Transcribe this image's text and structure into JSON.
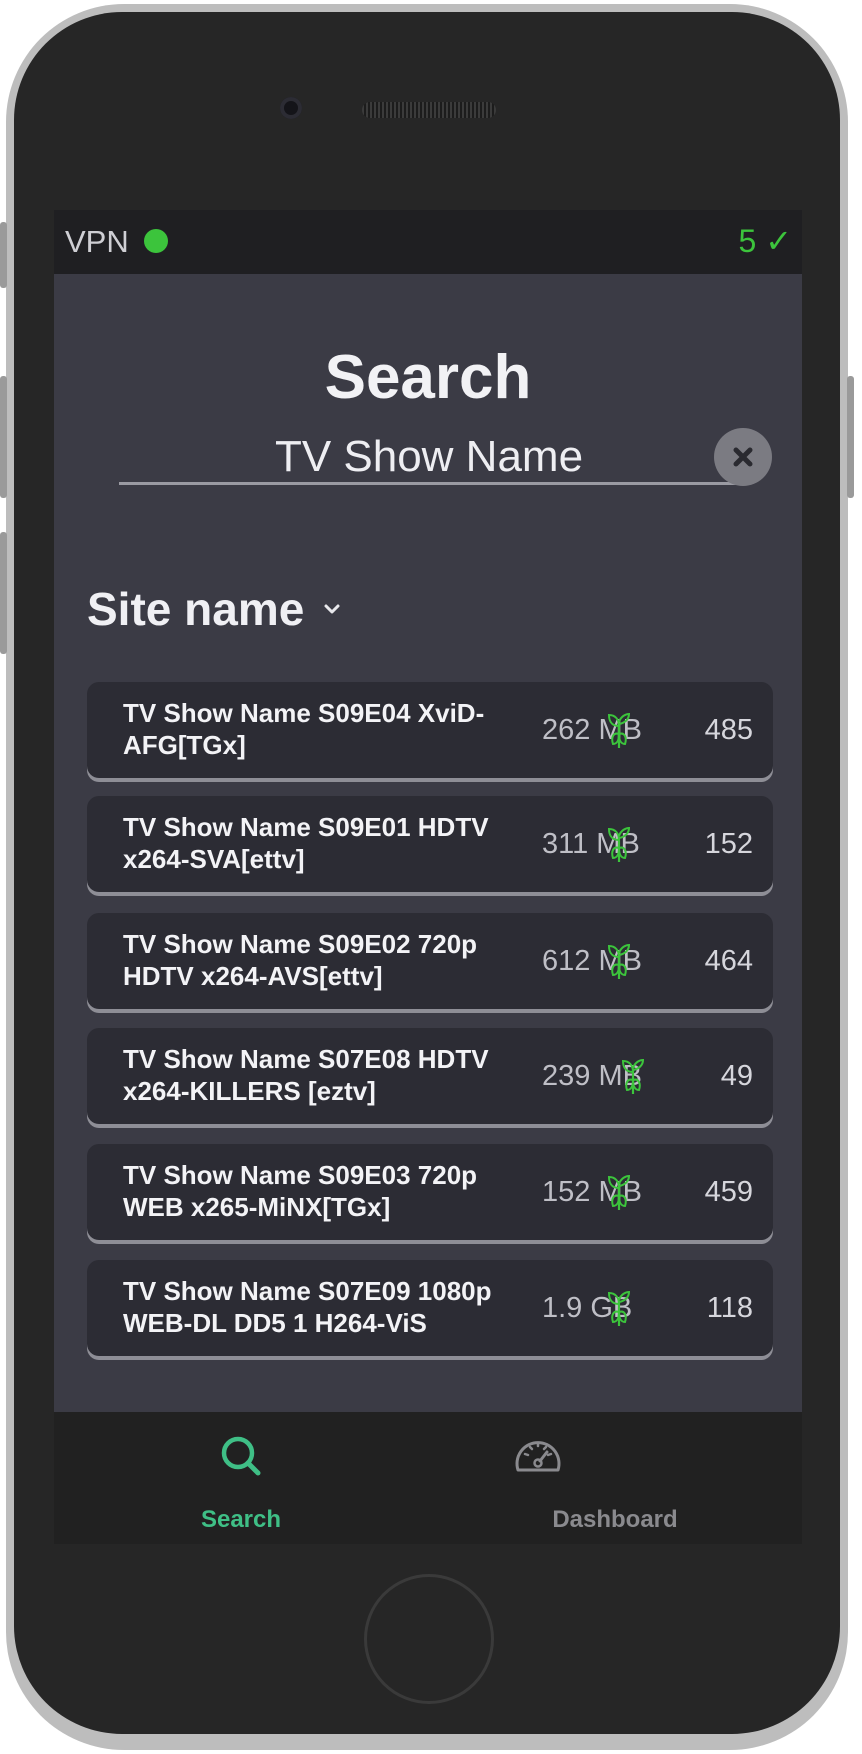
{
  "status": {
    "vpn_label": "VPN",
    "vpn_status_color": "#3cc43c",
    "completed": "5 ✓"
  },
  "search": {
    "title": "Search",
    "query": "TV Show Name",
    "clear_icon": "close-icon"
  },
  "site": {
    "selected": "Site name",
    "icon": "chevron-down-icon"
  },
  "results": [
    {
      "name": "TV Show Name S09E04 XviD-AFG[TGx]",
      "size": "262 MB",
      "seeds": "485"
    },
    {
      "name": "TV Show Name S09E01 HDTV x264-SVA[ettv]",
      "size": "311 MB",
      "seeds": "152"
    },
    {
      "name": "TV Show Name S09E02 720p HDTV x264-AVS[ettv]",
      "size": "612 MB",
      "seeds": "464"
    },
    {
      "name": "TV Show Name S07E08 HDTV x264-KILLERS [eztv]",
      "size": "239 MB",
      "seeds": "49"
    },
    {
      "name": "TV Show Name S09E03 720p WEB x265-MiNX[TGx]",
      "size": "152 MB",
      "seeds": "459"
    },
    {
      "name": "TV Show Name S07E09 1080p WEB-DL DD5 1 H264-ViS",
      "size": "1.9 GB",
      "seeds": "118"
    }
  ],
  "tabs": [
    {
      "label": "Search",
      "icon": "search-icon",
      "active": true
    },
    {
      "label": "Dashboard",
      "icon": "speedometer-icon",
      "active": false
    }
  ],
  "colors": {
    "accent": "#3cc43c",
    "active_tab": "#3fbf86",
    "inactive_tab": "#8a8a8e"
  }
}
